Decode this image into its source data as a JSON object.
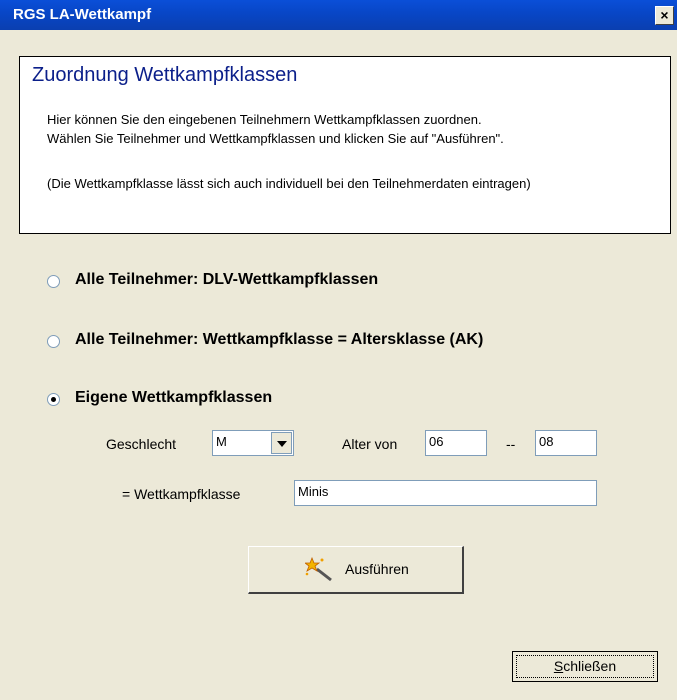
{
  "window": {
    "title": "RGS LA-Wettkampf",
    "close_glyph": "×"
  },
  "header": {
    "title": "Zuordnung Wettkampfklassen",
    "line1": "Hier können Sie den eingebenen Teilnehmern Wettkampfklassen zuordnen.",
    "line2": "Wählen Sie Teilnehmer und Wettkampfklassen und klicken Sie auf \"Ausführen\".",
    "line3": "(Die Wettkampfklasse lässt sich auch individuell bei den Teilnehmerdaten eintragen)"
  },
  "options": {
    "opt1": {
      "label": "Alle Teilnehmer: DLV-Wettkampfklassen",
      "checked": false
    },
    "opt2": {
      "label": "Alle Teilnehmer: Wettkampfklasse = Altersklasse (AK)",
      "checked": false
    },
    "opt3": {
      "label": "Eigene Wettkampfklassen",
      "checked": true
    }
  },
  "form": {
    "gender_label": "Geschlecht",
    "gender_value": "M",
    "age_label": "Alter von",
    "age_from": "06",
    "age_sep": "--",
    "age_to": "08",
    "class_label": "= Wettkampfklasse",
    "class_value": "Minis"
  },
  "buttons": {
    "execute_label": "Ausführen",
    "close_label_first": "S",
    "close_label_rest": "chließen"
  },
  "icons": {
    "execute": "magic-wand-icon"
  }
}
